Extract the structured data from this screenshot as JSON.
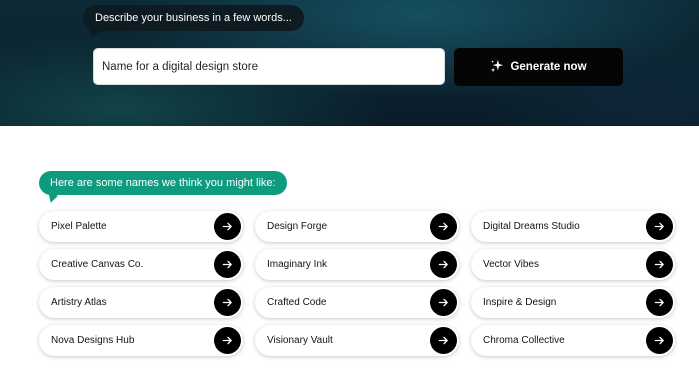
{
  "hero": {
    "prompt_bubble": "Describe your business in a few words...",
    "input_value": "Name for a digital design store",
    "generate_label": "Generate now",
    "generate_icon": "sparkles-icon"
  },
  "results": {
    "intro_bubble": "Here are some names we think you might like:",
    "names": [
      {
        "label": "Pixel Palette"
      },
      {
        "label": "Design Forge"
      },
      {
        "label": "Digital Dreams Studio"
      },
      {
        "label": "Creative Canvas Co."
      },
      {
        "label": "Imaginary Ink"
      },
      {
        "label": "Vector Vibes"
      },
      {
        "label": "Artistry Atlas"
      },
      {
        "label": "Crafted Code"
      },
      {
        "label": "Inspire & Design"
      },
      {
        "label": "Nova Designs Hub"
      },
      {
        "label": "Visionary Vault"
      },
      {
        "label": "Chroma Collective"
      }
    ],
    "arrow_icon": "arrow-right-icon"
  },
  "colors": {
    "accent_green": "#0e9c7e",
    "button_black": "#050505",
    "hero_dark": "#0b2330"
  }
}
